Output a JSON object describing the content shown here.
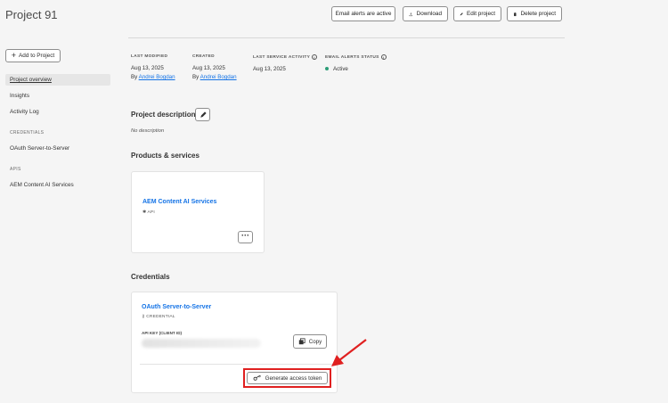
{
  "header": {
    "title": "Project 91",
    "buttons": {
      "email_alerts": "Email alerts are active",
      "download": "Download",
      "edit_project": "Edit project",
      "delete_project": "Delete project"
    }
  },
  "sidebar": {
    "add_button": "Add to Project",
    "items": [
      {
        "label": "Project overview"
      },
      {
        "label": "Insights"
      },
      {
        "label": "Activity Log"
      }
    ],
    "credentials_heading": "CREDENTIALS",
    "credentials_items": [
      {
        "label": "OAuth Server-to-Server"
      }
    ],
    "apis_heading": "APIS",
    "apis_items": [
      {
        "label": "AEM Content AI Services"
      }
    ]
  },
  "meta": {
    "last_modified": {
      "label": "LAST MODIFIED",
      "date": "Aug 13, 2025",
      "by_prefix": "By",
      "by_user": "Andrei Bogdan"
    },
    "created": {
      "label": "CREATED",
      "date": "Aug 13, 2025",
      "by_prefix": "By",
      "by_user": "Andrei Bogdan"
    },
    "last_service_activity": {
      "label": "LAST SERVICE ACTIVITY",
      "date": "Aug 13, 2025"
    },
    "email_alerts_status": {
      "label": "EMAIL ALERTS STATUS",
      "value": "Active",
      "status_color": "#2d9d78"
    }
  },
  "description": {
    "title": "Project description",
    "value": "No description"
  },
  "products": {
    "title": "Products & services",
    "card": {
      "name": "AEM Content AI Services",
      "type": "API"
    }
  },
  "credentials": {
    "title": "Credentials",
    "card": {
      "name": "OAuth Server-to-Server",
      "type": "CREDENTIAL",
      "api_key_label": "API KEY (CLIENT ID)",
      "copy_label": "Copy",
      "generate_label": "Generate access token"
    }
  },
  "colors": {
    "accent": "#1473e6",
    "highlight": "#e02020"
  }
}
